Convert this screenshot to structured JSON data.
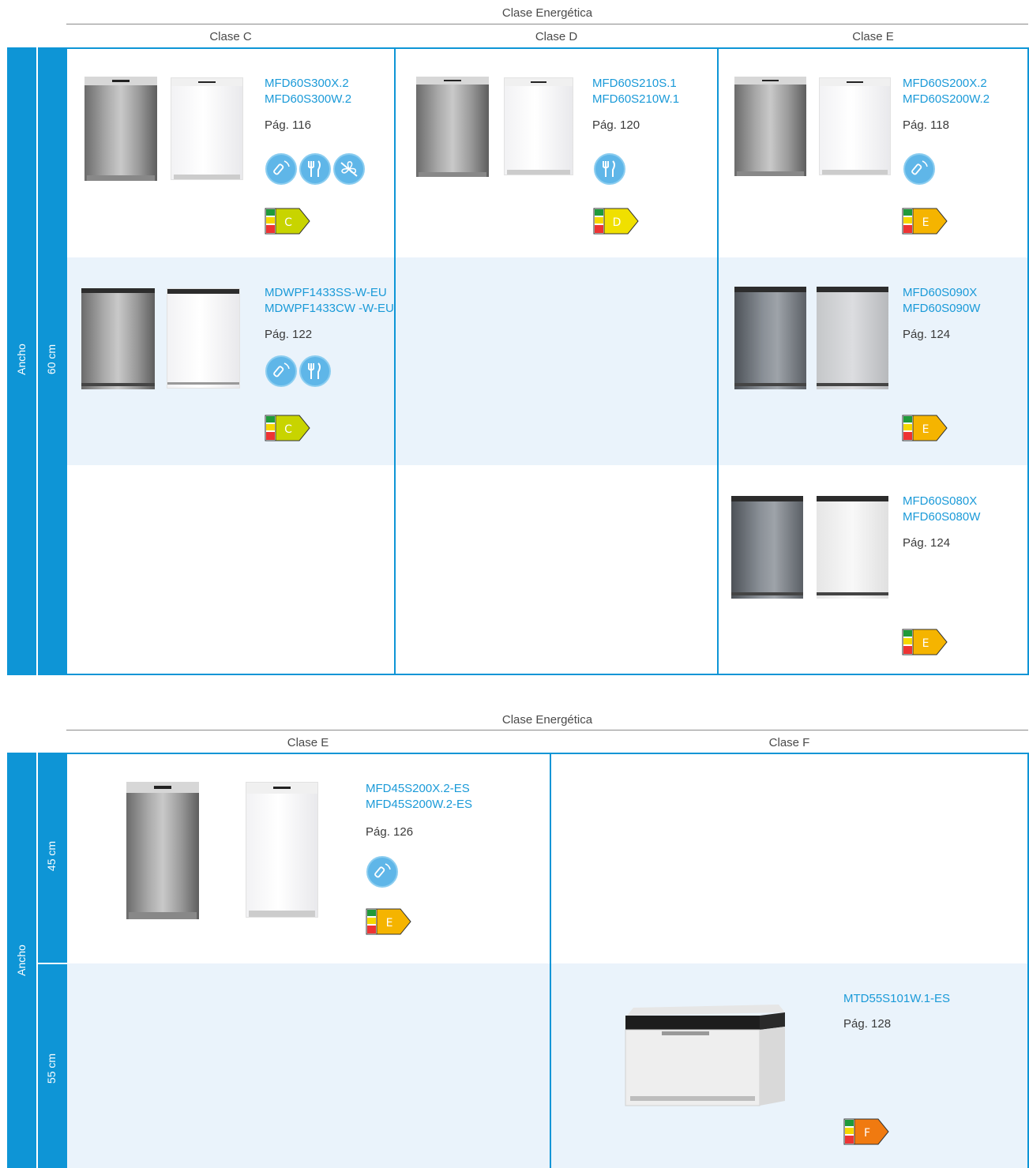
{
  "table1": {
    "header_title": "Clase Energética",
    "columns": [
      "Clase C",
      "Clase D",
      "Clase E"
    ],
    "side_label": "Ancho",
    "width_label": "60 cm",
    "cells": [
      {
        "models": [
          "MFD60S300X.2",
          "MFD60S300W.2"
        ],
        "page": "Pág. 116",
        "features": [
          "remote-icon",
          "cutlery-icon",
          "no-fan-icon"
        ],
        "energy_class": "C"
      },
      {
        "models": [
          "MFD60S210S.1",
          "MFD60S210W.1"
        ],
        "page": "Pág. 120",
        "features": [
          "cutlery-icon"
        ],
        "energy_class": "D"
      },
      {
        "models": [
          "MFD60S200X.2",
          "MFD60S200W.2"
        ],
        "page": "Pág. 118",
        "features": [
          "remote-icon"
        ],
        "energy_class": "E"
      },
      {
        "models": [
          "MDWPF1433SS-W-EU",
          "MDWPF1433CW -W-EU"
        ],
        "page": "Pág. 122",
        "features": [
          "remote-icon",
          "cutlery-icon"
        ],
        "energy_class": "C"
      },
      {
        "models": [
          "MFD60S090X",
          "MFD60S090W"
        ],
        "page": "Pág. 124",
        "features": [],
        "energy_class": "E"
      },
      {
        "models": [
          "MFD60S080X",
          "MFD60S080W"
        ],
        "page": "Pág. 124",
        "features": [],
        "energy_class": "E"
      }
    ]
  },
  "table2": {
    "header_title": "Clase Energética",
    "columns": [
      "Clase E",
      "Clase F"
    ],
    "side_label": "Ancho",
    "width_labels": [
      "45 cm",
      "55 cm"
    ],
    "cells": [
      {
        "models": [
          "MFD45S200X.2-ES",
          "MFD45S200W.2-ES"
        ],
        "page": "Pág. 126",
        "features": [
          "remote-icon"
        ],
        "energy_class": "E"
      },
      {
        "models": [
          "MTD55S101W.1-ES"
        ],
        "page": "Pág. 128",
        "features": [],
        "energy_class": "F"
      }
    ]
  },
  "colors": {
    "accent_blue": "#0e95d6",
    "model_text": "#1a9ad8",
    "band_bg": "#eaf3fb",
    "label_C": "#c8d400",
    "label_D": "#f0e000",
    "label_E": "#f5b400",
    "label_F": "#f07a10"
  }
}
